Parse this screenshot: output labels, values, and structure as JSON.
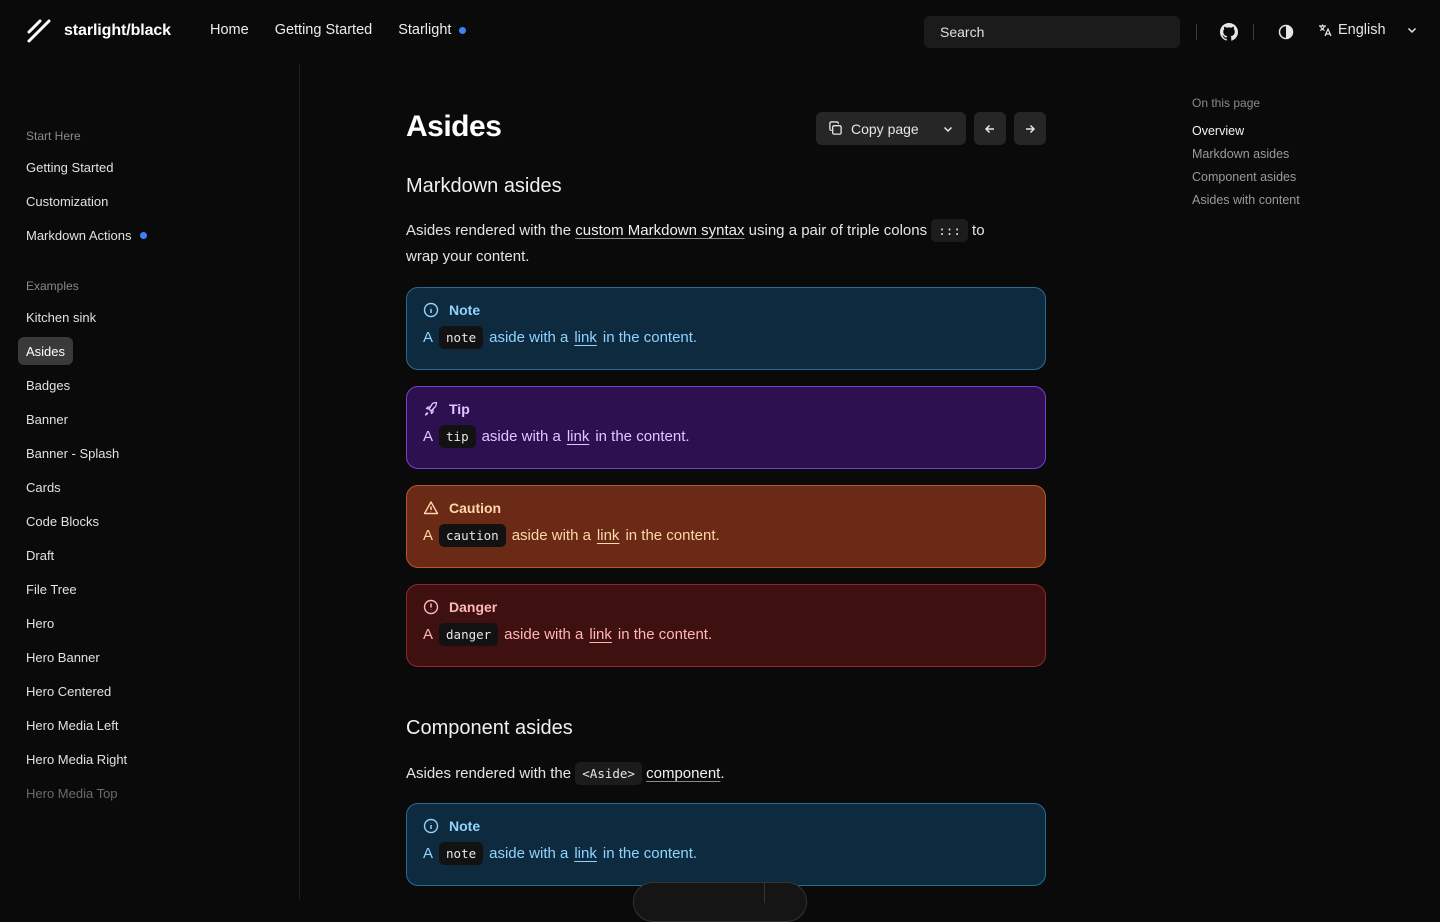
{
  "header": {
    "logo_text": "starlight/black",
    "nav": [
      {
        "label": "Home"
      },
      {
        "label": "Getting Started"
      },
      {
        "label": "Starlight",
        "has_dot": true
      }
    ],
    "search_placeholder": "Search",
    "language": "English"
  },
  "sidebar": {
    "groups": [
      {
        "label": "Start Here"
      },
      {
        "label": "Examples"
      }
    ],
    "start_items": [
      "Getting Started",
      "Customization",
      "Markdown Actions"
    ],
    "example_items": [
      "Kitchen sink",
      "Asides",
      "Badges",
      "Banner",
      "Banner - Splash",
      "Cards",
      "Code Blocks",
      "Draft",
      "File Tree",
      "Hero",
      "Hero Banner",
      "Hero Centered",
      "Hero Media Left",
      "Hero Media Right",
      "Hero Media Top"
    ],
    "active_item": "Asides"
  },
  "main": {
    "title": "Asides",
    "copy_page_label": "Copy page",
    "section1": {
      "heading": "Markdown asides",
      "text_before": "Asides rendered with the ",
      "link": "custom Markdown syntax",
      "text_middle": " using a pair of triple colons ",
      "code": ":::",
      "text_after": " to",
      "text_line2": "wrap your content."
    },
    "asides": [
      {
        "type": "note",
        "title": "Note",
        "code": "note"
      },
      {
        "type": "tip",
        "title": "Tip",
        "code": "tip"
      },
      {
        "type": "caution",
        "title": "Caution",
        "code": "caution"
      },
      {
        "type": "danger",
        "title": "Danger",
        "code": "danger"
      }
    ],
    "aside_body": {
      "prefix": "A",
      "middle": "aside with a",
      "link": "link",
      "suffix": "in the content."
    },
    "section2": {
      "heading": "Component asides",
      "text_before": "Asides rendered with the ",
      "code": "<Aside>",
      "link": "component",
      "text_after": "."
    },
    "component_aside": {
      "type": "note",
      "title": "Note",
      "code": "note"
    }
  },
  "toc": {
    "title": "On this page",
    "items": [
      "Overview",
      "Markdown asides",
      "Component asides",
      "Asides with content"
    ],
    "current": "Overview"
  },
  "colors": {
    "accent_dot": "#3b82f6",
    "note": "#8fd3ff",
    "tip": "#e1c6ff",
    "caution": "#ffd7a8",
    "danger": "#ffb7b7"
  }
}
